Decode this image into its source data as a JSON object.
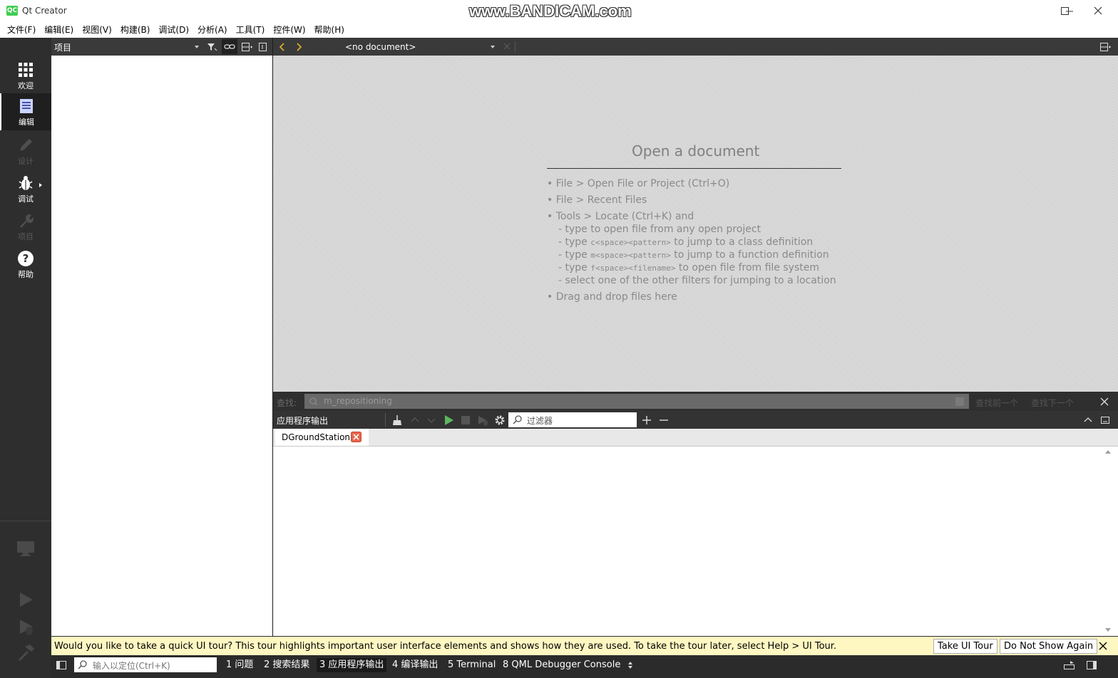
{
  "window": {
    "app_icon_text": "QC",
    "title": "Qt Creator",
    "watermark": "www.BANDICAM.com"
  },
  "menu": [
    "文件(F)",
    "编辑(E)",
    "视图(V)",
    "构建(B)",
    "调试(D)",
    "分析(A)",
    "工具(T)",
    "控件(W)",
    "帮助(H)"
  ],
  "modes": {
    "welcome": "欢迎",
    "edit": "编辑",
    "design": "设计",
    "debug": "调试",
    "projects": "项目",
    "help": "帮助"
  },
  "project_pane": {
    "title": "项目"
  },
  "editor": {
    "document_selector": "<no document>",
    "empty_title": "Open a document",
    "hints": {
      "h1": "• File > Open File or Project (Ctrl+O)",
      "h2": "• File > Recent Files",
      "h3": "• Tools > Locate (Ctrl+K) and",
      "h3a": "- type to open file from any open project",
      "h3b_pre": "- type ",
      "h3b_code": "c<space><pattern>",
      "h3b_post": " to jump to a class definition",
      "h3c_pre": "- type ",
      "h3c_code": "m<space><pattern>",
      "h3c_post": " to jump to a function definition",
      "h3d_pre": "- type ",
      "h3d_code": "f<space><filename>",
      "h3d_post": " to open file from file system",
      "h3e": "- select one of the other filters for jumping to a location",
      "h4": "• Drag and drop files here"
    }
  },
  "find": {
    "label": "查找:",
    "value": "m_repositioning",
    "find_prev": "查找前一个",
    "find_next": "查找下一个"
  },
  "output": {
    "title": "应用程序输出",
    "filter_placeholder": "过滤器",
    "tab_label": "DGroundStation"
  },
  "tour": {
    "message": "Would you like to take a quick UI tour? This tour highlights important user interface elements and shows how they are used. To take the tour later, select Help > UI Tour.",
    "take_label": "Take UI Tour",
    "dismiss_label": "Do Not Show Again"
  },
  "status": {
    "locator_placeholder": "输入以定位(Ctrl+K)",
    "tabs": [
      "1  问题",
      "2  搜索结果",
      "3  应用程序输出",
      "4  编译输出",
      "5  Terminal",
      "8  QML Debugger Console"
    ],
    "active_tab": "3  应用程序输出"
  },
  "colors": {
    "accent_green": "#41cd52",
    "run_green": "#4caf50",
    "tour_bg": "#fff7c2"
  }
}
